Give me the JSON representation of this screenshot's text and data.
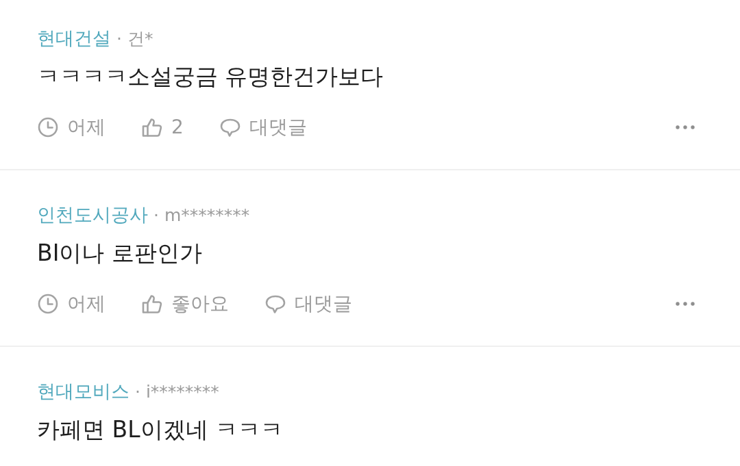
{
  "comments": [
    {
      "author": "현대건설",
      "handle": "· 건*",
      "text": "ㅋㅋㅋㅋ소설궁금 유명한건가보다",
      "actions": {
        "time": "어제",
        "like": "2",
        "reply": "대댓글"
      }
    },
    {
      "author": "인천도시공사",
      "handle": "· m********",
      "text": "BI이나 로판인가",
      "actions": {
        "time": "어제",
        "like": "좋아요",
        "reply": "대댓글"
      }
    },
    {
      "author": "현대모비스",
      "handle": "· i********",
      "text": "카페면 BL이겠네 ㅋㅋㅋ"
    }
  ]
}
